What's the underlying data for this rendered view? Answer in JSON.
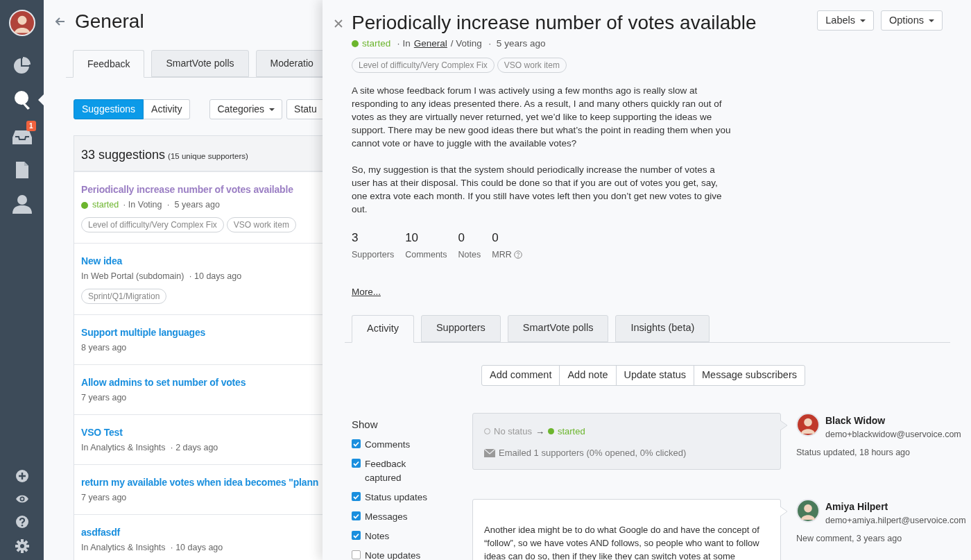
{
  "sidebar": {
    "nav": [
      {
        "kind": "avatar"
      },
      {
        "kind": "chart",
        "selected": false
      },
      {
        "kind": "bulb",
        "selected": true
      },
      {
        "kind": "inbox",
        "selected": false,
        "badge": "1"
      },
      {
        "kind": "document",
        "selected": false
      },
      {
        "kind": "user",
        "selected": false
      }
    ],
    "bottom": [
      {
        "kind": "plus"
      },
      {
        "kind": "eye"
      },
      {
        "kind": "help"
      },
      {
        "kind": "gear"
      }
    ]
  },
  "page": {
    "title": "General",
    "tabs": [
      {
        "label": "Feedback",
        "selected": true
      },
      {
        "label": "SmartVote polls",
        "selected": false
      },
      {
        "label": "Moderatio",
        "selected": false
      }
    ],
    "view_toggle": [
      {
        "label": "Suggestions",
        "selected": true
      },
      {
        "label": "Activity",
        "selected": false
      }
    ],
    "filters": [
      {
        "label": "Categories",
        "caret": true
      },
      {
        "label": "Statu",
        "caret": false
      }
    ],
    "list_header": {
      "count": "33 suggestions",
      "supporters": "(15 unique supporters)"
    },
    "suggestions": [
      {
        "title": "Periodically increase number of votes available",
        "visited": true,
        "status": {
          "label": "started",
          "color": "#6cb52d"
        },
        "meta": "· In Voting  ·  5 years ago",
        "tags": [
          "Level of difficulty/Very Complex Fix",
          "VSO work item"
        ]
      },
      {
        "title": "New idea",
        "visited": false,
        "meta": "In Web Portal (subdomain)  · 10 days ago",
        "tags": [
          "Sprint/Q1/Migration"
        ]
      },
      {
        "title": "Support multiple languages",
        "visited": false,
        "meta": "8 years ago"
      },
      {
        "title": "Allow admins to set number of votes",
        "visited": false,
        "meta": "7 years ago"
      },
      {
        "title": "VSO Test",
        "visited": false,
        "meta": "In Analytics & Insights  · 2 days ago"
      },
      {
        "title": "return my available votes when idea becomes \"plann",
        "visited": false,
        "meta": "7 years ago"
      },
      {
        "title": "asdfasdf",
        "visited": false,
        "meta": "In Analytics & Insights  · 10 days ago"
      }
    ]
  },
  "detail": {
    "title": "Periodically increase number of votes available",
    "status": {
      "label": "started",
      "color": "#6cb52d"
    },
    "location_prefix": "· In",
    "location_link": "General",
    "location_rest": "/ Voting",
    "time": "·  5 years ago",
    "header_buttons": [
      "Labels",
      "Options"
    ],
    "tags": [
      "Level of difficulty/Very Complex Fix",
      "VSO work item"
    ],
    "paragraphs": [
      "A site whose feedback forum I was actively using a few months ago is really slow at responding to any ideas presented there. As a result, I and many others quickly ran out of votes as they are virtually never returned, yet we’d like to keep supporting the ideas we support. There may be new good ideas there but what’s the point in reading them when you cannot vote or have to juggle with the available votes?",
      "So, my suggestion is that the system should periodically increase the number of votes a user has at their disposal. This could be done so that if you are out of votes you get, say, one extra vote each month. If you still have votes left then you don’t get new votes to give out."
    ],
    "stats": [
      {
        "value": "3",
        "label": "Supporters",
        "help": false
      },
      {
        "value": "10",
        "label": "Comments",
        "help": false
      },
      {
        "value": "0",
        "label": "Notes",
        "help": false
      },
      {
        "value": "0",
        "label": "MRR",
        "help": true
      }
    ],
    "more_link": "More...",
    "tabs": [
      {
        "label": "Activity",
        "selected": true
      },
      {
        "label": "Supporters",
        "selected": false
      },
      {
        "label": "SmartVote polls",
        "selected": false
      },
      {
        "label": "Insights (beta)",
        "selected": false
      }
    ],
    "actions": [
      "Add comment",
      "Add note",
      "Update status",
      "Message subscribers"
    ],
    "show": {
      "label": "Show",
      "options": [
        {
          "label": "Comments",
          "checked": true
        },
        {
          "label": "Feedback captured",
          "checked": true
        },
        {
          "label": "Status updates",
          "checked": true
        },
        {
          "label": "Messages",
          "checked": true
        },
        {
          "label": "Notes",
          "checked": true
        },
        {
          "label": "Note updates",
          "checked": false
        }
      ]
    },
    "activity": [
      {
        "kind": "status",
        "from": "No status",
        "arrow": "→",
        "to": {
          "label": "started",
          "color": "#6cb52d"
        },
        "email": "Emailed 1 supporters (0% opened, 0% clicked)",
        "author": "Black Widow",
        "author_email": "demo+blackwidow@uservoice.com",
        "event": "Status updated, 18 hours ago"
      },
      {
        "kind": "comment",
        "text": "Another idea might be to do what Google do and have the concept of “follow”, so we have votes AND follows, so people who want to follow ideas can do so, then if they like they can switch votes at some",
        "author": "Amiya Hilpert",
        "author_email": "demo+amiya.hilpert@uservoice.com",
        "event": "New comment, 3 years ago"
      }
    ]
  }
}
